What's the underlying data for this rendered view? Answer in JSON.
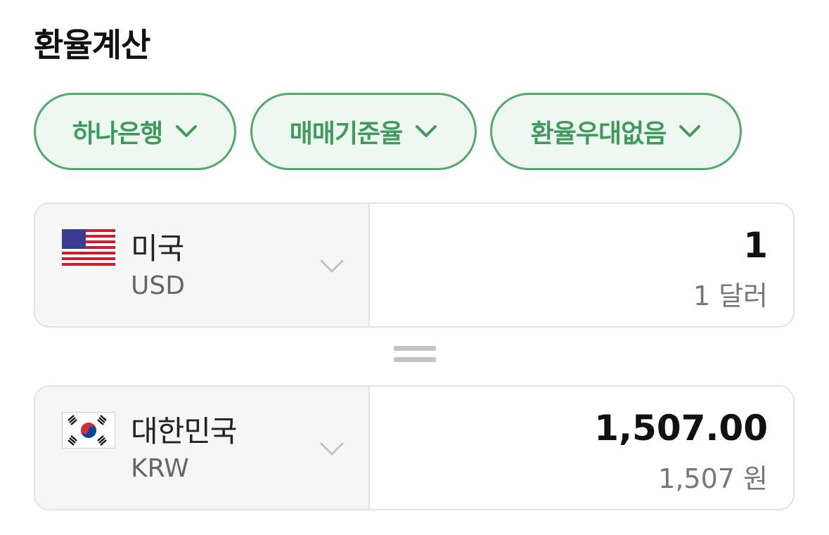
{
  "header": {
    "title": "환율계산"
  },
  "filters": [
    {
      "label": "하나은행"
    },
    {
      "label": "매매기준율"
    },
    {
      "label": "환율우대없음"
    }
  ],
  "from": {
    "country": "미국",
    "code": "USD",
    "flag_icon": "us-flag-icon",
    "amount": "1",
    "amount_text": "1 달러"
  },
  "to": {
    "country": "대한민국",
    "code": "KRW",
    "flag_icon": "kr-flag-icon",
    "amount": "1,507.00",
    "amount_text": "1,507 원"
  },
  "colors": {
    "accent": "#4ea96b",
    "chip_bg": "#eef8f1",
    "card_border": "#e2e2e2"
  }
}
